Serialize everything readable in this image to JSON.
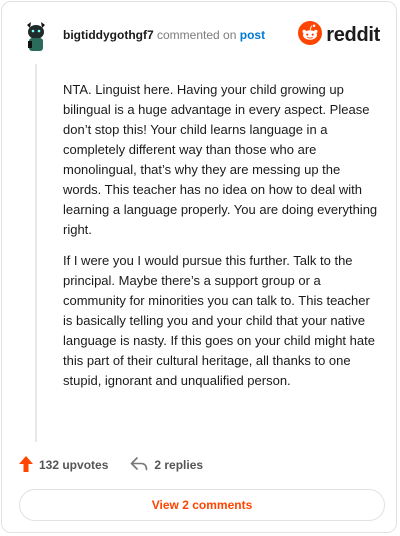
{
  "comment": {
    "username": "bigtiddygothgf7",
    "commented_on_text": "commented on",
    "post_link": "post",
    "paragraphs": [
      "NTA. Linguist here. Having your child growing up bilingual is a huge advantage in every aspect. Please don’t stop this! Your child learns language in a completely different way than those who are monolingual, that’s why they are messing up the words. This teacher has no idea on how to deal with learning a language properly. You are doing everything right.",
      "If I were you I would pursue this further. Talk to the principal. Maybe there’s a support group or a community for minorities you can talk to. This teacher is basically telling you and your child that your native language is nasty. If this goes on your child might hate this part of their cultural heritage, all thanks to one stupid, ignorant and unqualified person."
    ],
    "upvotes_label": "132 upvotes",
    "replies_label": "2 replies",
    "view_comments_label": "View 2 comments"
  },
  "brand": {
    "logo_text": "reddit",
    "accent": "#ff4500",
    "link_color": "#0079d3"
  },
  "icons": {
    "avatar": "avatar-image",
    "logo": "reddit-logo-icon",
    "upvote": "upvote-arrow-icon",
    "reply": "reply-arrow-icon"
  }
}
